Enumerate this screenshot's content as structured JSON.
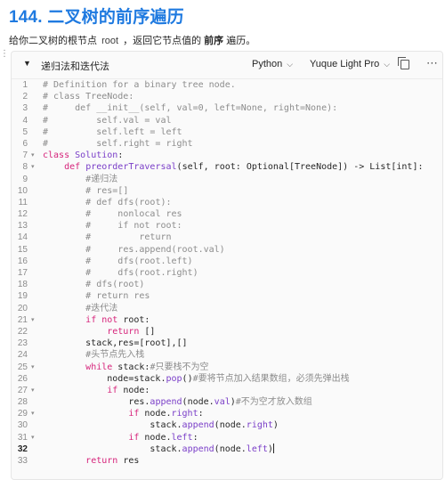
{
  "page": {
    "title": "144. 二叉树的前序遍历",
    "description_before": "给你二叉树的根节点 ",
    "description_code": "root",
    "description_middle": " ，返回它节点值的 ",
    "description_bold": "前序",
    "description_after": " 遍历。"
  },
  "code_block": {
    "title": "递归法和迭代法",
    "language": "Python",
    "theme": "Yuque Light Pro",
    "copy_icon": "copy-icon",
    "more_icon": "more-icon",
    "active_line": 32,
    "lines": [
      {
        "n": "1",
        "fold": "",
        "tokens": [
          {
            "t": "# Definition for a binary tree node.",
            "c": "cmt"
          }
        ]
      },
      {
        "n": "2",
        "fold": "",
        "tokens": [
          {
            "t": "# class TreeNode:",
            "c": "cmt"
          }
        ]
      },
      {
        "n": "3",
        "fold": "",
        "tokens": [
          {
            "t": "#     def __init__(self, val=0, left=None, right=None):",
            "c": "cmt"
          }
        ]
      },
      {
        "n": "4",
        "fold": "",
        "tokens": [
          {
            "t": "#         self.val = val",
            "c": "cmt"
          }
        ]
      },
      {
        "n": "5",
        "fold": "",
        "tokens": [
          {
            "t": "#         self.left = left",
            "c": "cmt"
          }
        ]
      },
      {
        "n": "6",
        "fold": "",
        "tokens": [
          {
            "t": "#         self.right = right",
            "c": "cmt"
          }
        ]
      },
      {
        "n": "7",
        "fold": "▾",
        "tokens": [
          {
            "t": "class",
            "c": "kw"
          },
          {
            "t": " ",
            "c": ""
          },
          {
            "t": "Solution",
            "c": "fn"
          },
          {
            "t": ":",
            "c": ""
          }
        ]
      },
      {
        "n": "8",
        "fold": "▾",
        "tokens": [
          {
            "t": "    ",
            "c": ""
          },
          {
            "t": "def",
            "c": "kw"
          },
          {
            "t": " ",
            "c": ""
          },
          {
            "t": "preorderTraversal",
            "c": "fn"
          },
          {
            "t": "(self, root: Optional[TreeNode]) -> List[int]:",
            "c": ""
          }
        ]
      },
      {
        "n": "9",
        "fold": "",
        "tokens": [
          {
            "t": "        ",
            "c": ""
          },
          {
            "t": "#递归法",
            "c": "cmt"
          }
        ]
      },
      {
        "n": "10",
        "fold": "",
        "tokens": [
          {
            "t": "        ",
            "c": ""
          },
          {
            "t": "# res=[]",
            "c": "cmt"
          }
        ]
      },
      {
        "n": "11",
        "fold": "",
        "tokens": [
          {
            "t": "        ",
            "c": ""
          },
          {
            "t": "# def dfs(root):",
            "c": "cmt"
          }
        ]
      },
      {
        "n": "12",
        "fold": "",
        "tokens": [
          {
            "t": "        ",
            "c": ""
          },
          {
            "t": "#     nonlocal res",
            "c": "cmt"
          }
        ]
      },
      {
        "n": "13",
        "fold": "",
        "tokens": [
          {
            "t": "        ",
            "c": ""
          },
          {
            "t": "#     if not root:",
            "c": "cmt"
          }
        ]
      },
      {
        "n": "14",
        "fold": "",
        "tokens": [
          {
            "t": "        ",
            "c": ""
          },
          {
            "t": "#         return",
            "c": "cmt"
          }
        ]
      },
      {
        "n": "15",
        "fold": "",
        "tokens": [
          {
            "t": "        ",
            "c": ""
          },
          {
            "t": "#     res.append(root.val)",
            "c": "cmt"
          }
        ]
      },
      {
        "n": "16",
        "fold": "",
        "tokens": [
          {
            "t": "        ",
            "c": ""
          },
          {
            "t": "#     dfs(root.left)",
            "c": "cmt"
          }
        ]
      },
      {
        "n": "17",
        "fold": "",
        "tokens": [
          {
            "t": "        ",
            "c": ""
          },
          {
            "t": "#     dfs(root.right)",
            "c": "cmt"
          }
        ]
      },
      {
        "n": "18",
        "fold": "",
        "tokens": [
          {
            "t": "        ",
            "c": ""
          },
          {
            "t": "# dfs(root)",
            "c": "cmt"
          }
        ]
      },
      {
        "n": "19",
        "fold": "",
        "tokens": [
          {
            "t": "        ",
            "c": ""
          },
          {
            "t": "# return res",
            "c": "cmt"
          }
        ]
      },
      {
        "n": "20",
        "fold": "",
        "tokens": [
          {
            "t": "        ",
            "c": ""
          },
          {
            "t": "#迭代法",
            "c": "cmt"
          }
        ]
      },
      {
        "n": "21",
        "fold": "▾",
        "tokens": [
          {
            "t": "        ",
            "c": ""
          },
          {
            "t": "if not",
            "c": "kw"
          },
          {
            "t": " root:",
            "c": ""
          }
        ]
      },
      {
        "n": "22",
        "fold": "",
        "tokens": [
          {
            "t": "            ",
            "c": ""
          },
          {
            "t": "return",
            "c": "kw"
          },
          {
            "t": " []",
            "c": ""
          }
        ]
      },
      {
        "n": "23",
        "fold": "",
        "tokens": [
          {
            "t": "        stack,res=[root],[]",
            "c": ""
          }
        ]
      },
      {
        "n": "24",
        "fold": "",
        "tokens": [
          {
            "t": "        ",
            "c": ""
          },
          {
            "t": "#头节点先入栈",
            "c": "cmt"
          }
        ]
      },
      {
        "n": "25",
        "fold": "▾",
        "tokens": [
          {
            "t": "        ",
            "c": ""
          },
          {
            "t": "while",
            "c": "kw"
          },
          {
            "t": " stack:",
            "c": ""
          },
          {
            "t": "#只要栈不为空",
            "c": "cmt"
          }
        ]
      },
      {
        "n": "26",
        "fold": "",
        "tokens": [
          {
            "t": "            node=stack.",
            "c": ""
          },
          {
            "t": "pop",
            "c": "fn"
          },
          {
            "t": "()",
            "c": ""
          },
          {
            "t": "#要将节点加入结果数组，必须先弹出栈",
            "c": "cmt"
          }
        ]
      },
      {
        "n": "27",
        "fold": "▾",
        "tokens": [
          {
            "t": "            ",
            "c": ""
          },
          {
            "t": "if",
            "c": "kw"
          },
          {
            "t": " node:",
            "c": ""
          }
        ]
      },
      {
        "n": "28",
        "fold": "",
        "tokens": [
          {
            "t": "                res.",
            "c": ""
          },
          {
            "t": "append",
            "c": "fn"
          },
          {
            "t": "(node.",
            "c": ""
          },
          {
            "t": "val",
            "c": "fn"
          },
          {
            "t": ")",
            "c": ""
          },
          {
            "t": "#不为空才放入数组",
            "c": "cmt"
          }
        ]
      },
      {
        "n": "29",
        "fold": "▾",
        "tokens": [
          {
            "t": "                ",
            "c": ""
          },
          {
            "t": "if",
            "c": "kw"
          },
          {
            "t": " node.",
            "c": ""
          },
          {
            "t": "right",
            "c": "fn"
          },
          {
            "t": ":",
            "c": ""
          }
        ]
      },
      {
        "n": "30",
        "fold": "",
        "tokens": [
          {
            "t": "                    stack.",
            "c": ""
          },
          {
            "t": "append",
            "c": "fn"
          },
          {
            "t": "(node.",
            "c": ""
          },
          {
            "t": "right",
            "c": "fn"
          },
          {
            "t": ")",
            "c": ""
          }
        ]
      },
      {
        "n": "31",
        "fold": "▾",
        "tokens": [
          {
            "t": "                ",
            "c": ""
          },
          {
            "t": "if",
            "c": "kw"
          },
          {
            "t": " node.",
            "c": ""
          },
          {
            "t": "left",
            "c": "fn"
          },
          {
            "t": ":",
            "c": ""
          }
        ]
      },
      {
        "n": "32",
        "fold": "",
        "tokens": [
          {
            "t": "                    stack.",
            "c": ""
          },
          {
            "t": "append",
            "c": "fn"
          },
          {
            "t": "(node.",
            "c": ""
          },
          {
            "t": "left",
            "c": "fn"
          },
          {
            "t": ")",
            "c": ""
          }
        ]
      },
      {
        "n": "33",
        "fold": "",
        "tokens": [
          {
            "t": "        ",
            "c": ""
          },
          {
            "t": "return",
            "c": "kw"
          },
          {
            "t": " res",
            "c": ""
          }
        ]
      }
    ]
  }
}
